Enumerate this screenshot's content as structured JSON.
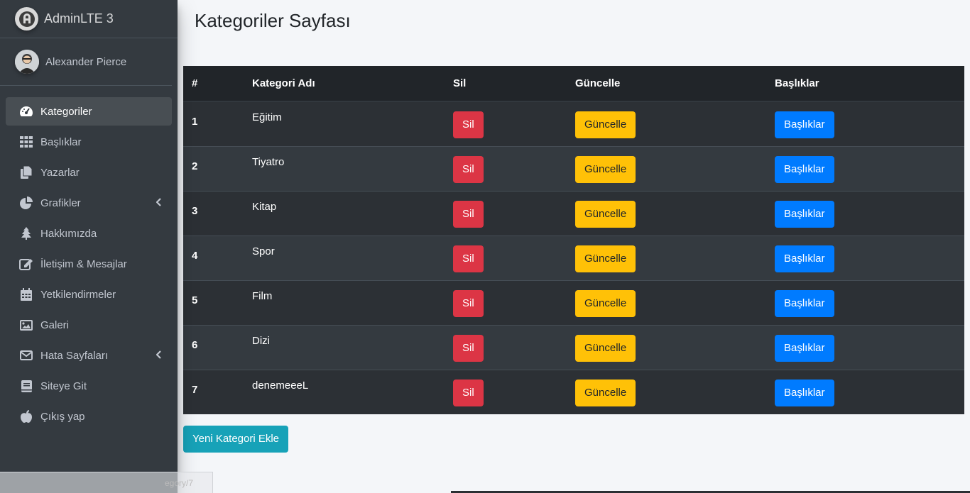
{
  "brand": {
    "title": "AdminLTE 3"
  },
  "user": {
    "name": "Alexander Pierce"
  },
  "sidebar": {
    "items": [
      {
        "label": "Kategoriler",
        "icon": "dashboard-icon",
        "active": true
      },
      {
        "label": "Başlıklar",
        "icon": "grid-icon"
      },
      {
        "label": "Yazarlar",
        "icon": "copy-icon"
      },
      {
        "label": "Grafikler",
        "icon": "chart-pie-icon",
        "has_submenu": true
      },
      {
        "label": "Hakkımızda",
        "icon": "tree-icon"
      },
      {
        "label": "İletişim & Mesajlar",
        "icon": "edit-icon"
      },
      {
        "label": "Yetkilendirmeler",
        "icon": "calendar-icon"
      },
      {
        "label": "Galeri",
        "icon": "image-icon"
      },
      {
        "label": "Hata Sayfaları",
        "icon": "envelope-icon",
        "has_submenu": true
      },
      {
        "label": "Siteye Git",
        "icon": "book-icon"
      },
      {
        "label": "Çıkış yap",
        "icon": "apple-icon"
      }
    ]
  },
  "page": {
    "title": "Kategoriler Sayfası"
  },
  "table": {
    "headers": [
      "#",
      "Kategori Adı",
      "Sil",
      "Güncelle",
      "Başlıklar"
    ],
    "rows": [
      {
        "id": "1",
        "name": "Eğitim"
      },
      {
        "id": "2",
        "name": "Tiyatro"
      },
      {
        "id": "3",
        "name": "Kitap"
      },
      {
        "id": "4",
        "name": "Spor"
      },
      {
        "id": "5",
        "name": "Film"
      },
      {
        "id": "6",
        "name": "Dizi"
      },
      {
        "id": "7",
        "name": "denemeeeL"
      }
    ],
    "delete_label": "Sil",
    "update_label": "Güncelle",
    "headings_label": "Başlıklar"
  },
  "add_button": {
    "label": "Yeni Kategori Ekle"
  },
  "statusbar": {
    "url": "egory/7"
  },
  "colors": {
    "sidebar_bg": "#343a40",
    "danger": "#dc3545",
    "warning": "#ffc107",
    "primary": "#007bff",
    "info": "#17a2b8"
  }
}
